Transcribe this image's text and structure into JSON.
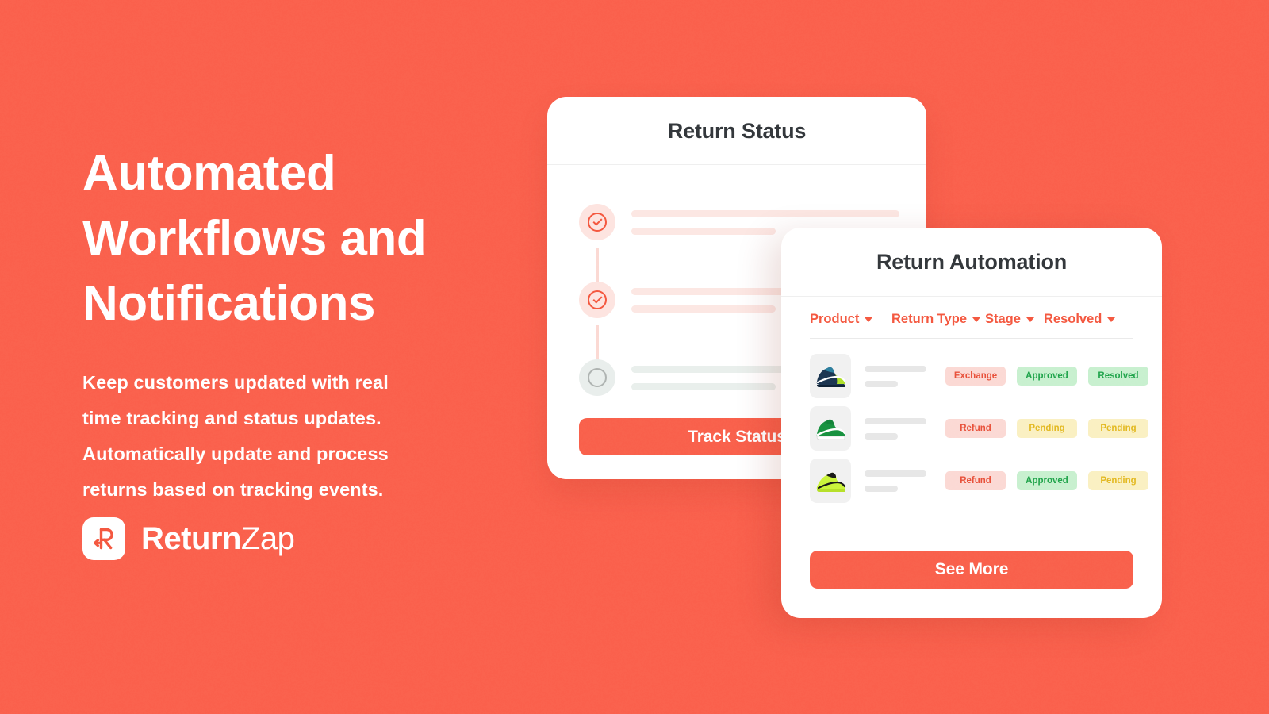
{
  "background_color": "#FA604C",
  "accent_color": "#F9604B",
  "hero": {
    "headline": "Automated\nWorkflows and\nNotifications",
    "subcopy": "Keep customers updated with real\ntime tracking and status updates.\nAutomatically update and process\nreturns based on tracking events."
  },
  "logo": {
    "icon_name": "returnzap-r-arrow-logo",
    "word_bold": "Return",
    "word_light": "Zap"
  },
  "status_card": {
    "title": "Return Status",
    "timeline": [
      {
        "state": "done",
        "icon": "check-circle-icon"
      },
      {
        "state": "done",
        "icon": "check-circle-icon"
      },
      {
        "state": "pending",
        "icon": "empty-circle-icon"
      }
    ],
    "track_button_label": "Track Status"
  },
  "automation_card": {
    "title": "Return Automation",
    "filters": [
      {
        "label": "Product",
        "icon": "chevron-down-icon"
      },
      {
        "label": "Return Type",
        "icon": "chevron-down-icon"
      },
      {
        "label": "Stage",
        "icon": "chevron-down-icon"
      },
      {
        "label": "Resolved",
        "icon": "chevron-down-icon"
      }
    ],
    "rows": [
      {
        "thumbnail": "navy-teal-running-shoe-icon",
        "return_type": "Exchange",
        "return_type_tone": "red",
        "stage": "Approved",
        "stage_tone": "green",
        "resolved": "Resolved",
        "resolved_tone": "green"
      },
      {
        "thumbnail": "green-white-sneaker-icon",
        "return_type": "Refund",
        "return_type_tone": "red",
        "stage": "Pending",
        "stage_tone": "yellow",
        "resolved": "Pending",
        "resolved_tone": "yellow"
      },
      {
        "thumbnail": "neon-yellow-sneaker-icon",
        "return_type": "Refund",
        "return_type_tone": "red",
        "stage": "Approved",
        "stage_tone": "green",
        "resolved": "Pending",
        "resolved_tone": "yellow"
      }
    ],
    "see_more_label": "See More"
  }
}
